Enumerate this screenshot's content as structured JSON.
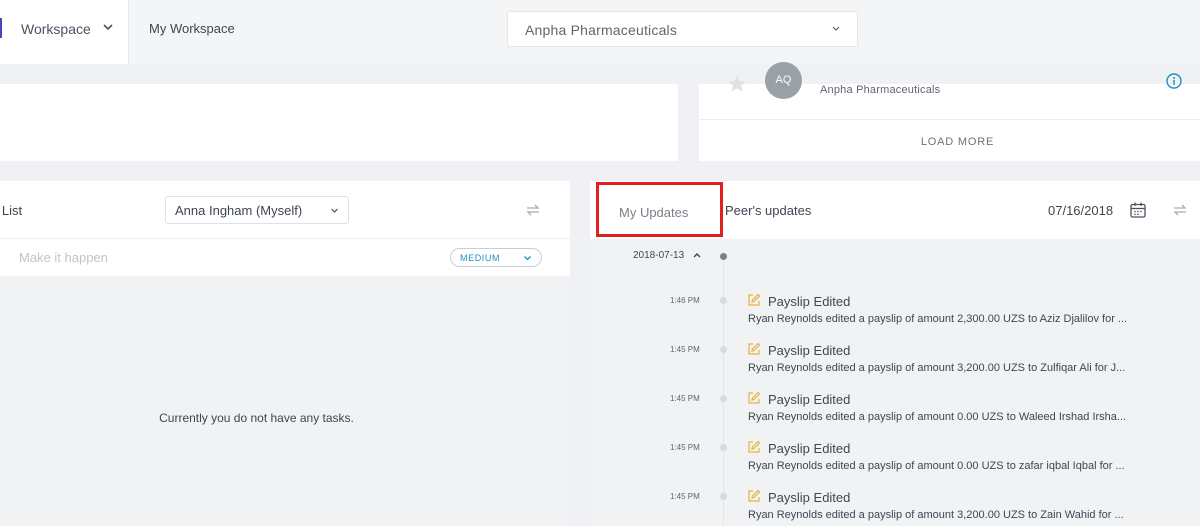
{
  "colors": {
    "accent": "#4a45b8",
    "highlight_border": "#e11f21",
    "priority_blue": "#1f8ec4",
    "edit_icon": "#e8b43a"
  },
  "header": {
    "workspace_label": "Workspace",
    "breadcrumb": "My Workspace",
    "company_select": "Anpha Pharmaceuticals"
  },
  "people_card": {
    "avatar_initials": "AQ",
    "company": "Anpha Pharmaceuticals",
    "load_more": "LOAD MORE"
  },
  "todo": {
    "title": "o List",
    "user_select": "Anna Ingham (Myself)",
    "task_placeholder": "Make it happen",
    "priority": "MEDIUM",
    "empty_message": "Currently you do not have any tasks."
  },
  "updates": {
    "tab_my": "My Updates",
    "tab_peer": "Peer's updates",
    "date": "07/16/2018",
    "group_date": "2018-07-13",
    "entries": [
      {
        "time": "1:46 PM",
        "title": "Payslip Edited",
        "desc": "Ryan Reynolds edited a payslip of amount 2,300.00 UZS to Aziz Djalilov for ..."
      },
      {
        "time": "1:45 PM",
        "title": "Payslip Edited",
        "desc": "Ryan Reynolds edited a payslip of amount 3,200.00 UZS to Zulfiqar Ali for J..."
      },
      {
        "time": "1:45 PM",
        "title": "Payslip Edited",
        "desc": "Ryan Reynolds edited a payslip of amount 0.00 UZS to Waleed Irshad Irsha..."
      },
      {
        "time": "1:45 PM",
        "title": "Payslip Edited",
        "desc": "Ryan Reynolds edited a payslip of amount 0.00 UZS to zafar iqbal Iqbal for ..."
      },
      {
        "time": "1:45 PM",
        "title": "Payslip Edited",
        "desc": "Ryan Reynolds edited a payslip of amount 3,200.00 UZS to Zain Wahid for ..."
      }
    ]
  }
}
